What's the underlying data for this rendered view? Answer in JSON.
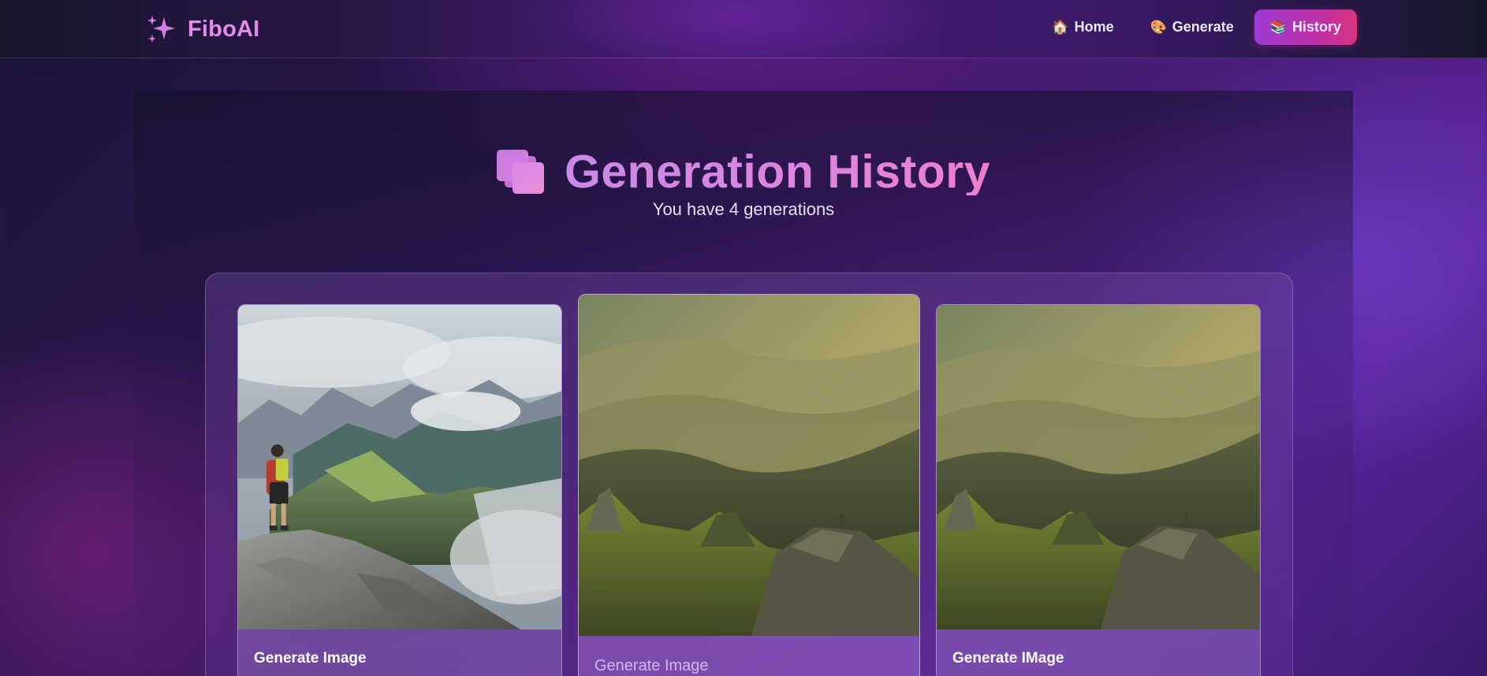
{
  "app": {
    "name": "FiboAI"
  },
  "nav": {
    "items": [
      {
        "icon": "🏠",
        "label": "Home",
        "active": false
      },
      {
        "icon": "🎨",
        "label": "Generate",
        "active": false
      },
      {
        "icon": "📚",
        "label": "History",
        "active": true
      }
    ]
  },
  "page": {
    "title": "Generation History",
    "subtitle": "You have 4 generations"
  },
  "cards": [
    {
      "title": "Generate Image",
      "image": "hiker-on-mountain-cliff"
    },
    {
      "title": "Generate Image",
      "image": "sunlit-mountain-valley"
    },
    {
      "title": "Generate IMage",
      "image": "sunlit-mountain-valley"
    }
  ],
  "colors": {
    "accent": "#e48be8",
    "active_nav_start": "#9c3ad6",
    "active_nav_end": "#d8347d"
  }
}
